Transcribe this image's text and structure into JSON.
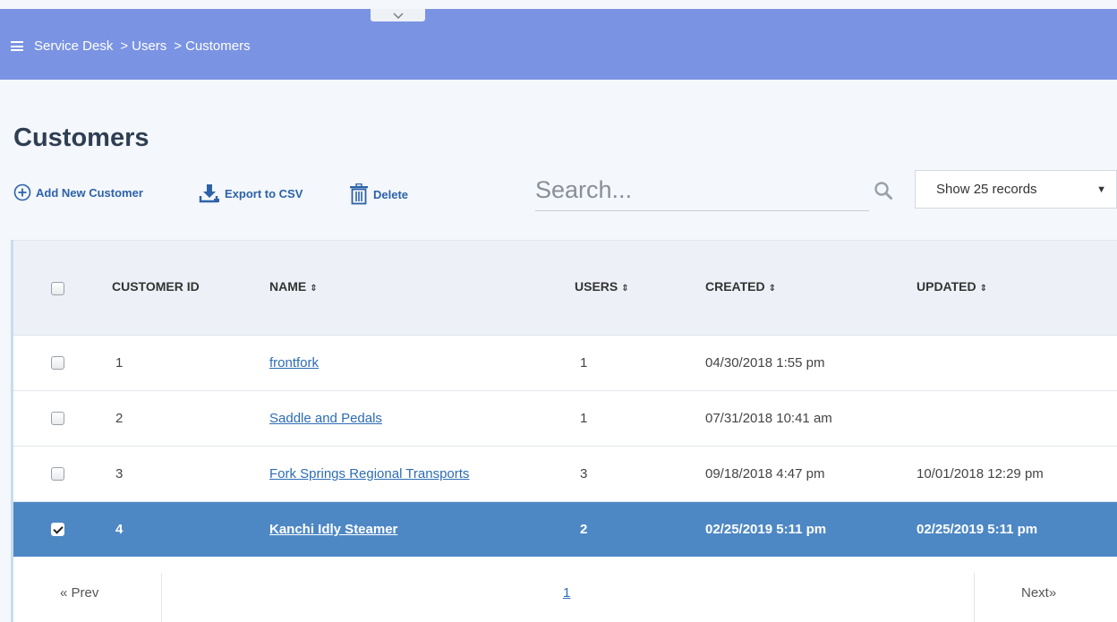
{
  "header": {
    "breadcrumb": [
      "Service Desk",
      "Users",
      "Customers"
    ],
    "separator": ">",
    "background": "#7a93e2"
  },
  "page": {
    "title": "Customers"
  },
  "toolbar": {
    "add_label": "Add New Customer",
    "export_label": "Export to CSV",
    "delete_label": "Delete"
  },
  "search": {
    "placeholder": "Search...",
    "value": ""
  },
  "records": {
    "selected": "Show 25 records"
  },
  "table": {
    "columns": [
      "CUSTOMER ID",
      "NAME",
      "USERS",
      "CREATED",
      "UPDATED"
    ],
    "sort_icon": "⇕",
    "rows": [
      {
        "id": "1",
        "name": "frontfork",
        "users": "1",
        "created": "04/30/2018 1:55 pm",
        "updated": "",
        "checked": false
      },
      {
        "id": "2",
        "name": "Saddle and Pedals",
        "users": "1",
        "created": "07/31/2018 10:41 am",
        "updated": "",
        "checked": false
      },
      {
        "id": "3",
        "name": "Fork Springs Regional Transports",
        "users": "3",
        "created": "09/18/2018 4:47 pm",
        "updated": "10/01/2018 12:29 pm",
        "checked": false
      },
      {
        "id": "4",
        "name": "Kanchi Idly Steamer",
        "users": "2",
        "created": "02/25/2019 5:11 pm",
        "updated": "02/25/2019 5:11 pm",
        "checked": true
      }
    ],
    "selected_row_color": "#4e88c4"
  },
  "pagination": {
    "prev": "« Prev",
    "current": "1",
    "next": "Next»"
  },
  "colors": {
    "link": "#2d6cb3",
    "toolbar_text": "#2d62a8"
  }
}
